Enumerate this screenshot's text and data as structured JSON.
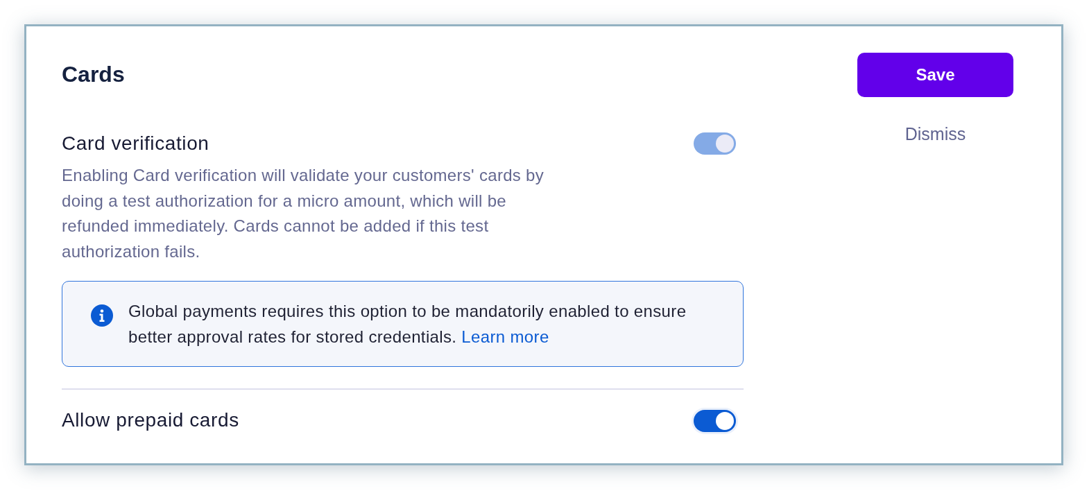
{
  "section": {
    "title": "Cards"
  },
  "settings": [
    {
      "title": "Card verification",
      "description": "Enabling Card verification will validate your customers' cards by doing a test authorization for a micro amount, which will be refunded immediately. Cards cannot be added if this test authorization fails.",
      "on": true,
      "disabled": true,
      "notice": {
        "text": "Global payments requires this option to be mandatorily enabled to ensure better approval rates for stored credentials.",
        "link": "Learn more"
      }
    },
    {
      "title": "Allow prepaid cards",
      "on": true,
      "disabled": false
    }
  ],
  "actions": {
    "save": "Save",
    "dismiss": "Dismiss"
  }
}
